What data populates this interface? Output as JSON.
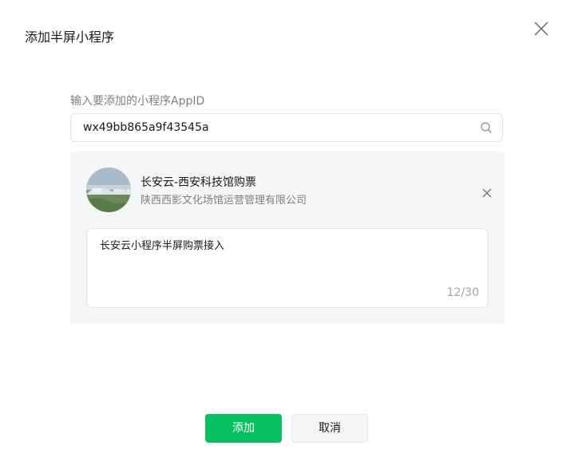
{
  "dialog": {
    "title": "添加半屏小程序"
  },
  "appid_field": {
    "label": "输入要添加的小程序AppID",
    "value": "wx49bb865a9f43545a"
  },
  "result": {
    "app_name": "长安云-西安科技馆购票",
    "company": "陕西西影文化场馆运营管理有限公司",
    "description": "长安云小程序半屏购票接入",
    "counter": "12/30"
  },
  "footer": {
    "confirm_label": "添加",
    "cancel_label": "取消"
  },
  "colors": {
    "primary": "#07c160",
    "panel_bg": "#f5f6f7",
    "muted_text": "#7f7f7f"
  },
  "icons": {
    "close": "close-icon",
    "search": "search-icon",
    "remove": "remove-icon"
  }
}
